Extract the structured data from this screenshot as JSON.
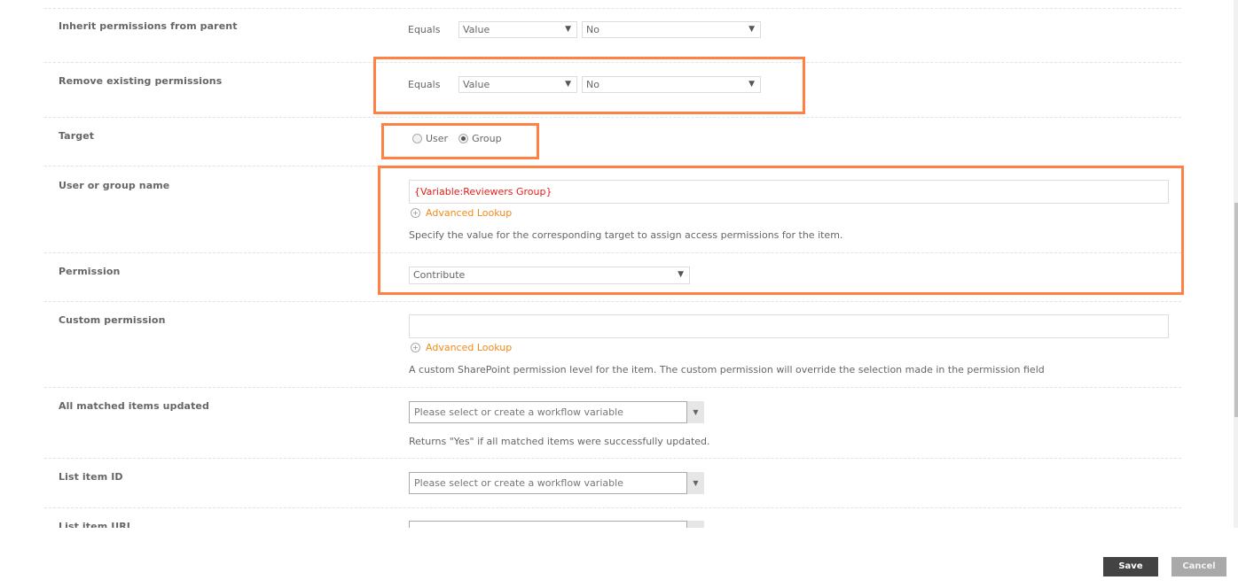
{
  "fields": {
    "inherit": {
      "label": "Inherit permissions from parent",
      "operator": "Equals",
      "type_value": "Value",
      "value": "No"
    },
    "remove": {
      "label": "Remove existing permissions",
      "operator": "Equals",
      "type_value": "Value",
      "value": "No"
    },
    "target": {
      "label": "Target",
      "options": [
        {
          "label": "User",
          "checked": false
        },
        {
          "label": "Group",
          "checked": true
        }
      ]
    },
    "user_group": {
      "label": "User or group name",
      "value": "{Variable:Reviewers Group}",
      "lookup_label": "Advanced Lookup",
      "help": "Specify the value for the corresponding target to assign access permissions for the item."
    },
    "permission": {
      "label": "Permission",
      "value": "Contribute"
    },
    "custom_permission": {
      "label": "Custom permission",
      "value": "",
      "lookup_label": "Advanced Lookup",
      "help": "A custom SharePoint permission level for the item. The custom permission will override the selection made in the permission field"
    },
    "all_matched": {
      "label": "All matched items updated",
      "placeholder": "Please select or create a workflow variable",
      "help": "Returns \"Yes\" if all matched items were successfully updated."
    },
    "list_item_id": {
      "label": "List item ID",
      "placeholder": "Please select or create a workflow variable"
    },
    "list_item_url": {
      "label": "List item URL",
      "placeholder": ""
    }
  },
  "icons": {
    "dropdown": "▼",
    "lookup": "+"
  },
  "footer": {
    "save_label": "Save",
    "cancel_label": "Cancel"
  },
  "colors": {
    "highlight": "#ff8143",
    "lookup_link": "#f18a1c",
    "variable_text": "#e0211b",
    "save_button": "#434343",
    "cancel_button": "#a9a9a9"
  }
}
